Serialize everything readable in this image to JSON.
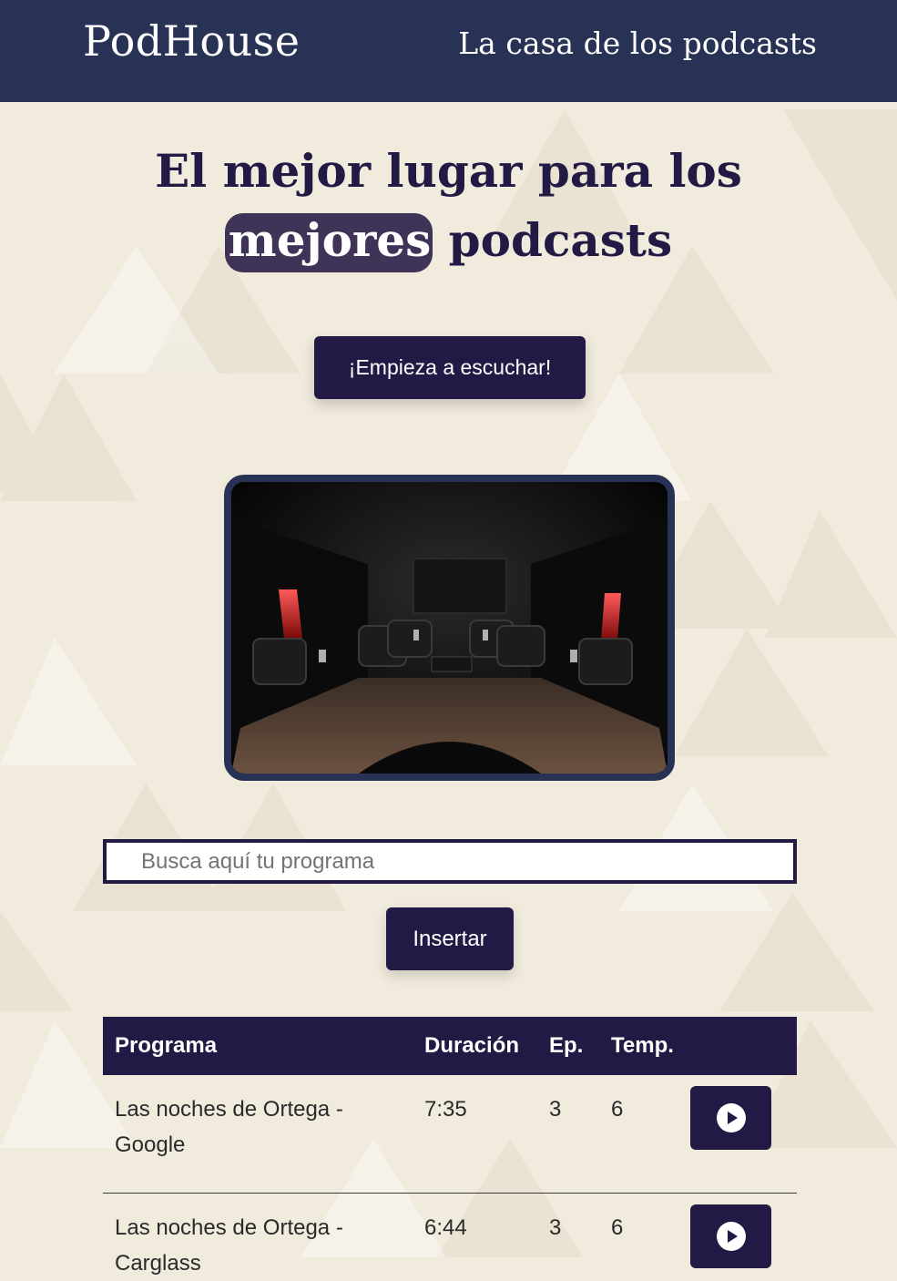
{
  "header": {
    "brand": "PodHouse",
    "tagline": "La casa de los podcasts"
  },
  "hero": {
    "title_before": "El mejor lugar para los ",
    "title_highlight": "mejores",
    "title_after": " podcasts",
    "cta_label": "¡Empieza a escuchar!"
  },
  "search": {
    "placeholder": "Busca aquí tu programa",
    "value": "",
    "button_label": "Insertar"
  },
  "table": {
    "headers": {
      "program": "Programa",
      "duration": "Duración",
      "episode": "Ep.",
      "season": "Temp."
    },
    "rows": [
      {
        "program": "Las noches de Ortega - Google",
        "duration": "7:35",
        "episode": "3",
        "season": "6",
        "action_icon": "play-circle-icon"
      },
      {
        "program": "Las noches de Ortega - Carglass",
        "duration": "6:44",
        "episode": "3",
        "season": "6",
        "action_icon": "play-circle-icon"
      }
    ]
  },
  "theme": {
    "header_bg": "#283254",
    "primary": "#221a45",
    "highlight_bg": "#3f3357",
    "page_bg": "#f1ebdd"
  }
}
